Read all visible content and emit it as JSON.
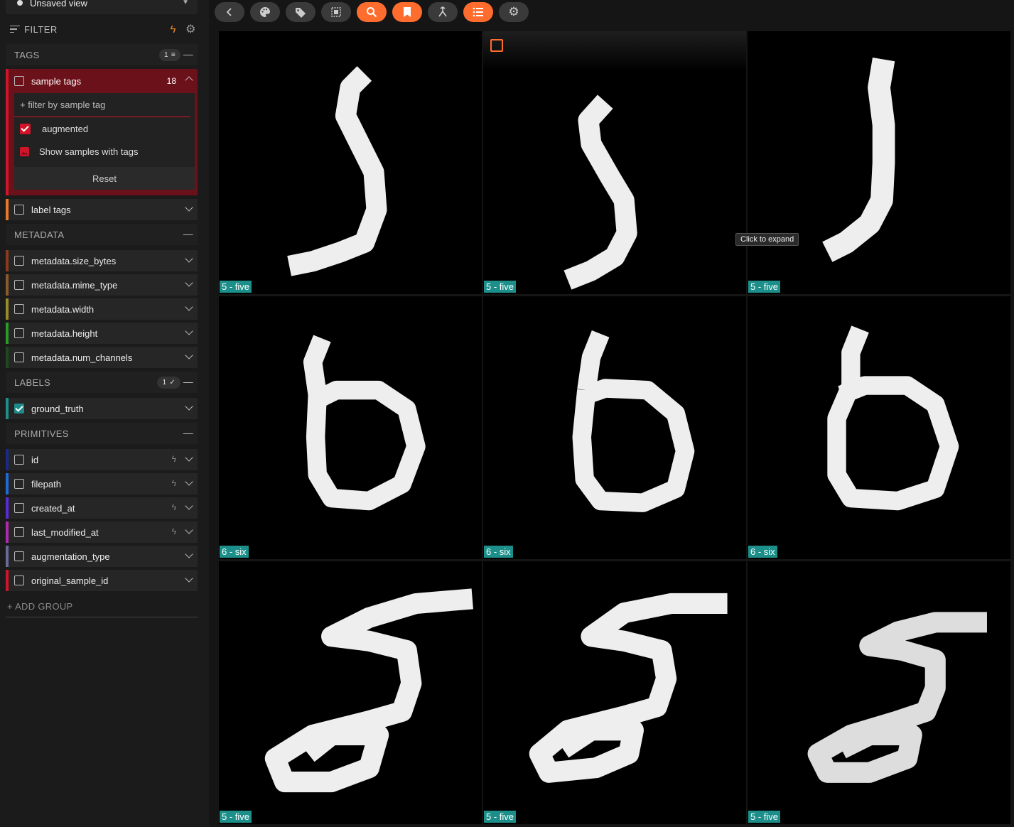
{
  "sidebar": {
    "view_select": "Unsaved view",
    "filter_label": "FILTER",
    "tags_group": {
      "title": "TAGS",
      "pill": "1"
    },
    "sample_tags": {
      "label": "sample tags",
      "count": "18",
      "filter_placeholder": "+ filter by sample tag",
      "tag_item": "augmented",
      "show_samples": "Show samples with tags",
      "reset": "Reset"
    },
    "label_tags": "label tags",
    "metadata_group": {
      "title": "METADATA"
    },
    "metadata_fields": [
      "metadata.size_bytes",
      "metadata.mime_type",
      "metadata.width",
      "metadata.height",
      "metadata.num_channels"
    ],
    "labels_group": {
      "title": "LABELS",
      "pill": "1"
    },
    "ground_truth": "ground_truth",
    "primitives_group": {
      "title": "PRIMITIVES"
    },
    "primitive_fields": [
      "id",
      "filepath",
      "created_at",
      "last_modified_at",
      "augmentation_type",
      "original_sample_id"
    ],
    "add_group": "+ ADD GROUP"
  },
  "colors": {
    "accent": "#ff6d2e",
    "tag_red": "#d2142a",
    "label_teal": "#1d8f8a"
  },
  "toolbar": {
    "icons": [
      "back-icon",
      "palette-icon",
      "tag-icon",
      "select-icon",
      "search-icon",
      "bookmark-icon",
      "merge-icon",
      "list-icon",
      "gear-icon"
    ]
  },
  "grid": {
    "tooltip": "Click to expand",
    "samples": [
      {
        "label": "5 - five",
        "digit": "five"
      },
      {
        "label": "5 - five",
        "digit": "five"
      },
      {
        "label": "5 - five",
        "digit": "five"
      },
      {
        "label": "6 - six",
        "digit": "six"
      },
      {
        "label": "6 - six",
        "digit": "six"
      },
      {
        "label": "6 - six",
        "digit": "six"
      },
      {
        "label": "5 - five",
        "digit": "five"
      },
      {
        "label": "5 - five",
        "digit": "five"
      },
      {
        "label": "5 - five",
        "digit": "five"
      }
    ]
  }
}
